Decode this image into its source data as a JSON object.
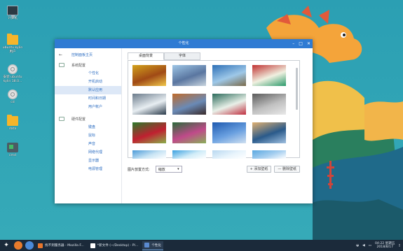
{
  "desktop": {
    "icons": [
      {
        "label": "计算机",
        "icon": "computer-icon"
      },
      {
        "label": "ubuntu kylin 用户",
        "icon": "folder-icon"
      },
      {
        "label": "安装 ubuntu kylin 18.0...",
        "icon": "disc-icon"
      },
      {
        "label": "cd",
        "icon": "disc-icon"
      },
      {
        "label": "data",
        "icon": "folder-icon"
      },
      {
        "label": "cmd",
        "icon": "usb-drive-icon"
      }
    ]
  },
  "window": {
    "title": "个性化",
    "controls": {
      "minimize": "–",
      "maximize": "□",
      "close": "✕"
    }
  },
  "sidebar": {
    "back_arrow": "←",
    "back_label": "控制面板主页",
    "groups": [
      {
        "label": "系统配置",
        "items": [
          "个性化",
          "开机启动",
          "默认应用",
          "时间和日期",
          "用户帐户"
        ]
      },
      {
        "label": "硬件配置",
        "items": [
          "键盘",
          "鼠标",
          "声音",
          "网络代理",
          "显示器",
          "电源管理"
        ]
      }
    ],
    "active_item": "默认应用"
  },
  "tabs": [
    "桌面背景",
    "字体"
  ],
  "active_tab": "桌面背景",
  "gallery": {
    "thumbnails": [
      {
        "name": "autumn-leaves",
        "colors": [
          "#d2a21c",
          "#a04a16",
          "#f0c84a"
        ]
      },
      {
        "name": "temple-of-heaven",
        "colors": [
          "#9ec6e6",
          "#5a76a0",
          "#c8d4de"
        ]
      },
      {
        "name": "coast-rocks",
        "colors": [
          "#2c6fb6",
          "#9ec8e8",
          "#7a6a4a"
        ]
      },
      {
        "name": "green-illustration",
        "colors": [
          "#c03030",
          "#f0f0e0",
          "#2a9a6a"
        ]
      },
      {
        "name": "snowy-mountain",
        "colors": [
          "#6a7a8a",
          "#e8eef2",
          "#2a3a4a"
        ]
      },
      {
        "name": "red-canyon",
        "colors": [
          "#c06a2a",
          "#6a8ab6",
          "#3a2a2a"
        ]
      },
      {
        "name": "green-flower-art",
        "colors": [
          "#2a6a5a",
          "#e8f0e8",
          "#c03040"
        ]
      },
      {
        "name": "dandelion",
        "colors": [
          "#5a5a5a",
          "#c0c0c0",
          "#e8e8e8"
        ]
      },
      {
        "name": "red-berries",
        "colors": [
          "#2a7a2a",
          "#c02030",
          "#8ab04a"
        ]
      },
      {
        "name": "pink-flower",
        "colors": [
          "#2a6a3a",
          "#c04a8a",
          "#8ab05a"
        ]
      },
      {
        "name": "blue-sky",
        "colors": [
          "#1e5ab0",
          "#6aa0e0",
          "#d0e0f0"
        ]
      },
      {
        "name": "sea-sunset",
        "colors": [
          "#e0b070",
          "#2a5a8a",
          "#a0c0e0"
        ]
      },
      {
        "name": "sky-partial-1",
        "colors": [
          "#4a9ad8",
          "#c8e4f4",
          "#ffffff"
        ]
      },
      {
        "name": "sky-partial-2",
        "colors": [
          "#3aa0e0",
          "#d0ecf8",
          "#ffffff"
        ]
      },
      {
        "name": "sky-partial-3",
        "colors": [
          "#b8d8f0",
          "#e8f4fc",
          "#ffffff"
        ]
      },
      {
        "name": "sky-partial-4",
        "colors": [
          "#5aa8e0",
          "#a8d0f0",
          "#ffffff"
        ]
      }
    ]
  },
  "picture_mode": {
    "label": "图片放置方式:",
    "value": "缩放",
    "arrow": "▾"
  },
  "buttons": {
    "add": "+ 添加壁纸",
    "delete": "— 删除壁纸"
  },
  "taskbar": {
    "start_icon": "kylin-start-icon",
    "tasks": [
      {
        "label": "找不到服务器 - Mozilla F...",
        "icon": "firefox-icon",
        "color": "#e8762c"
      },
      {
        "label": "*新文件 (~/Desktop) - Pl...",
        "icon": "text-editor-icon",
        "color": "#ffffff"
      },
      {
        "label": "个性化",
        "icon": "settings-icon",
        "color": "#5a8ad0"
      }
    ],
    "clock_time": "04:22 星期五",
    "clock_date": "2018/8/17"
  },
  "colors": {
    "accent": "#2f7bd3",
    "taskbar": "#1b2a3a",
    "sidebar_active": "#dde8f7"
  }
}
